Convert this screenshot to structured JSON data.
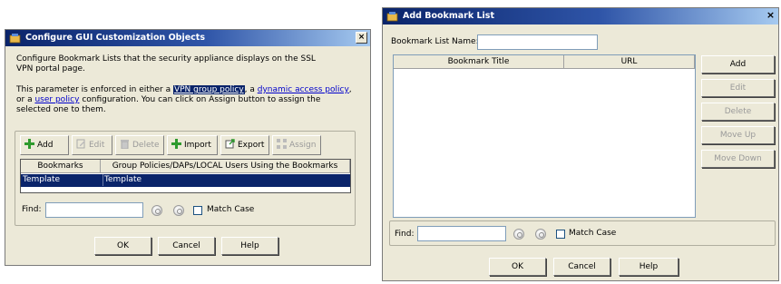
{
  "left_dialog": {
    "title": "Configure GUI Customization Objects",
    "close_label": "×",
    "description": "Configure Bookmark Lists that the security appliance displays on the SSL VPN portal page.",
    "enforce_text_1": "This parameter is enforced in either a ",
    "link_vpn_group": "VPN group policy",
    "enforce_text_2": ", a ",
    "link_dap": "dynamic access policy",
    "enforce_text_3": ",",
    "enforce_text_4": "or a ",
    "link_user_policy": "user policy",
    "enforce_text_5": " configuration. You can click on Assign button to assign the selected one to them.",
    "toolbar": {
      "add": "Add",
      "edit": "Edit",
      "delete": "Delete",
      "import": "Import",
      "export": "Export",
      "assign": "Assign"
    },
    "table": {
      "columns": [
        "Bookmarks",
        "Group Policies/DAPs/LOCAL Users Using the Bookmarks"
      ],
      "rows": [
        [
          "Template",
          "Template"
        ]
      ]
    },
    "find_label": "Find:",
    "match_case": "Match Case",
    "ok": "OK",
    "cancel": "Cancel",
    "help": "Help"
  },
  "right_dialog": {
    "title": "Add Bookmark List",
    "close_label": "×",
    "name_label": "Bookmark List Name:",
    "table": {
      "columns": [
        "Bookmark Title",
        "URL"
      ]
    },
    "buttons": {
      "add": "Add",
      "edit": "Edit",
      "delete": "Delete",
      "move_up": "Move Up",
      "move_down": "Move Down"
    },
    "find_label": "Find:",
    "match_case": "Match Case",
    "ok": "OK",
    "cancel": "Cancel",
    "help": "Help"
  },
  "colors": {
    "selection": "#0a246a",
    "titlebar_start": "#0a246a",
    "link": "#0000cc",
    "add_icon": "#2e9a2e"
  }
}
